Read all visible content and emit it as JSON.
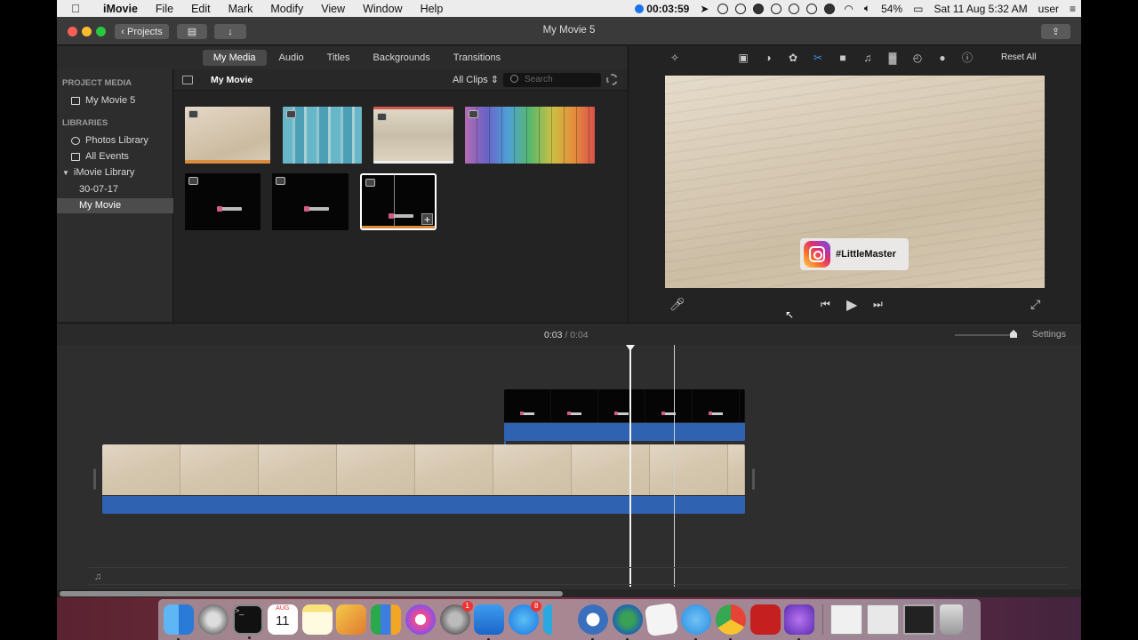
{
  "menubar": {
    "app": "iMovie",
    "menus": [
      "File",
      "Edit",
      "Mark",
      "Modify",
      "View",
      "Window",
      "Help"
    ],
    "recording_time": "00:03:59",
    "battery": "54%",
    "datetime": "Sat 11 Aug  5:32 AM",
    "user": "user"
  },
  "window": {
    "title": "My Movie 5",
    "projects_button": "Projects"
  },
  "media_tabs": [
    "My Media",
    "Audio",
    "Titles",
    "Backgrounds",
    "Transitions"
  ],
  "sidebar": {
    "project_media_heading": "PROJECT MEDIA",
    "project_item": "My Movie 5",
    "libraries_heading": "LIBRARIES",
    "libraries": [
      "Photos Library",
      "All Events",
      "iMovie Library",
      "30-07-17",
      "My Movie"
    ]
  },
  "browser": {
    "title": "My Movie",
    "filter": "All Clips",
    "search_placeholder": "Search"
  },
  "viewer": {
    "reset_label": "Reset All",
    "overlay_text": "#LittleMaster"
  },
  "timeline": {
    "current_time": "0:03",
    "separator": "/",
    "duration": "0:04",
    "settings_label": "Settings"
  },
  "dock": {
    "calendar_month": "AUG",
    "calendar_day": "11",
    "badge_prefs": "1",
    "badge_appstore": "8"
  },
  "colors": {
    "accent_blue": "#2f63b2",
    "selected_border": "#ffffff",
    "clip_marker": "#d98b3e"
  }
}
